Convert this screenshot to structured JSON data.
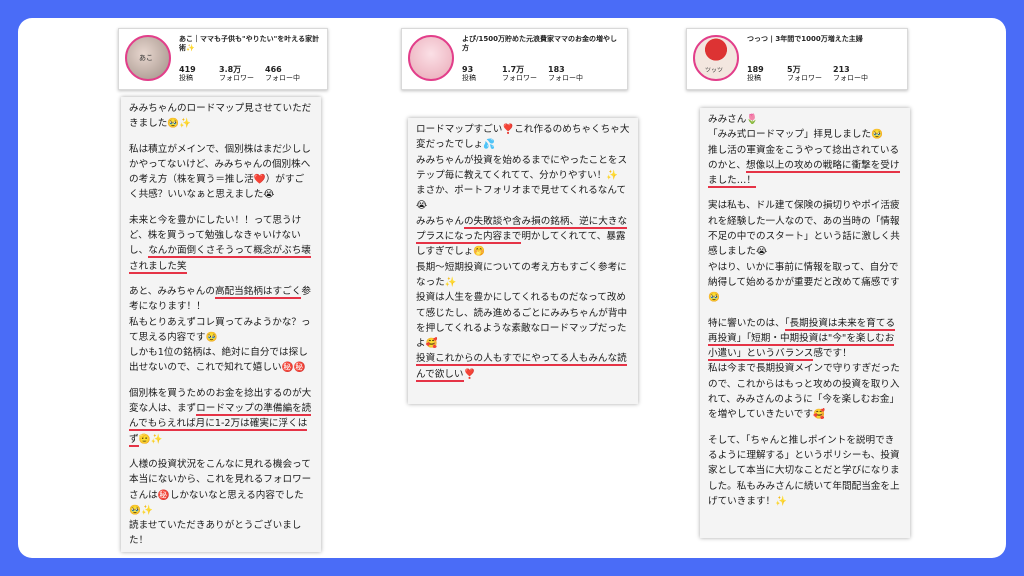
{
  "profiles": [
    {
      "name": "あこ｜ママも子供も\"やりたい\"を叶える家計術✨",
      "avatar_label": "あこ",
      "posts": "419",
      "followers": "3.8万",
      "following": "466",
      "posts_label": "投稿",
      "followers_label": "フォロワー",
      "following_label": "フォロー中"
    },
    {
      "name": "よぴ/1500万貯めた元浪費家ママのお金の増やし方",
      "avatar_label": "",
      "posts": "93",
      "followers": "1.7万",
      "following": "183",
      "posts_label": "投稿",
      "followers_label": "フォロワー",
      "following_label": "フォロー中"
    },
    {
      "name": "つっつ | 3年間で1000万増えた主婦",
      "avatar_label": "ツッツ",
      "posts": "189",
      "followers": "5万",
      "following": "213",
      "posts_label": "投稿",
      "followers_label": "フォロワー",
      "following_label": "フォロー中"
    }
  ],
  "testimonials": {
    "col1": {
      "p1": "みみちゃんのロードマップ見させていただきました🥹✨",
      "p2": "私は積立がメインで、個別株はまだ少ししかやってないけど、みみちゃんの個別株への考え方（株を買う＝推し活❤️）がすごく共感？いいなぁと思えました😭",
      "p3a": "未来と今を豊かにしたい！！って思うけど、株を買うって勉強しなきゃいけないし、",
      "p3b": "なんか面倒くさそうって概念がぶち壊されました笑",
      "p4a": "あと、みみちゃんの",
      "p4b": "高配当銘柄はすごく",
      "p4c": "参考になります！！\n私もとりあえずコレ買ってみようかな？って思える内容です🥹\nしかも1位の銘柄は、絶対に自分では探し出せないので、これで知れて嬉しい㊙️㊙️",
      "p5a": "個別株を買うためのお金を捻出するのが大変な人は、まず",
      "p5b": "ロードマップの準備編を読んでもらえれば月に1-2万は確実に浮くはず",
      "p5c": "🫡✨",
      "p6": "人様の投資状況をこんなに見れる機会って本当にないから、これを見れるフォロワーさんは㊙️しかないなと思える内容でした🥹✨\n読ませていただきありがとうございました！"
    },
    "col2": {
      "p1": "ロードマップすごい❣️これ作るのめちゃくちゃ大変だったでしょ💦\nみみちゃんが投資を始めるまでにやったことをステップ毎に教えてくれてて、分かりやすい！✨\nまさか、ポートフォリオまで見せてくれるなんて😭",
      "p2a": "みみちゃん",
      "p2b": "の失敗談や含み損の銘柄、逆に大きなプラスになった内容まで",
      "p2c": "明かしてくれてて、暴露しすぎでしょ🤭\n長期〜短期投資についての考え方もすごく参考になった✨\n投資は人生を豊かにしてくれるものだなって改めて感じたし、読み進めるごとにみみちゃんが背中を押してくれるような素敵なロードマップだったよ🥰",
      "p3a": "投資これからの人もすでにやってる人も",
      "p3b": "みんな読んで欲しい",
      "p3c": "❣️"
    },
    "col3": {
      "p1": "みみさん🌷\n「みみ式ロードマップ」拝見しました🥹\n推し活の軍資金をこうやって捻出されているのかと、",
      "p1b": "想像以上の攻めの戦略に衝撃を受けました…！",
      "p2": "実は私も、ドル建て保険の損切りやポイ活疲れを経験した一人なので、あの当時の「情報不足の中でのスタート」という話に激しく共感しました😭\nやはり、いかに事前に情報を取って、自分で納得して始めるかが重要だと改めて痛感です🥹",
      "p3a": "特に響いたのは、",
      "p3b": "「長期投資は未来を育てる再投資」「短期・中期投資は\"今\"を楽しむお小遣い」というバランス",
      "p3c": "感です！\n私は今まで長期投資メインで守りすぎだったので、これからはもっと攻めの投資を取り入れて、みみさんのように「今を楽しむお金」を増やしていきたいです🥰",
      "p4": "そして、「ちゃんと推しポイントを説明できるように理解する」というポリシーも、投資家として本当に大切なことだと学びになりました。私もみみさんに続いて年間配当金を上げていきます！✨"
    }
  }
}
